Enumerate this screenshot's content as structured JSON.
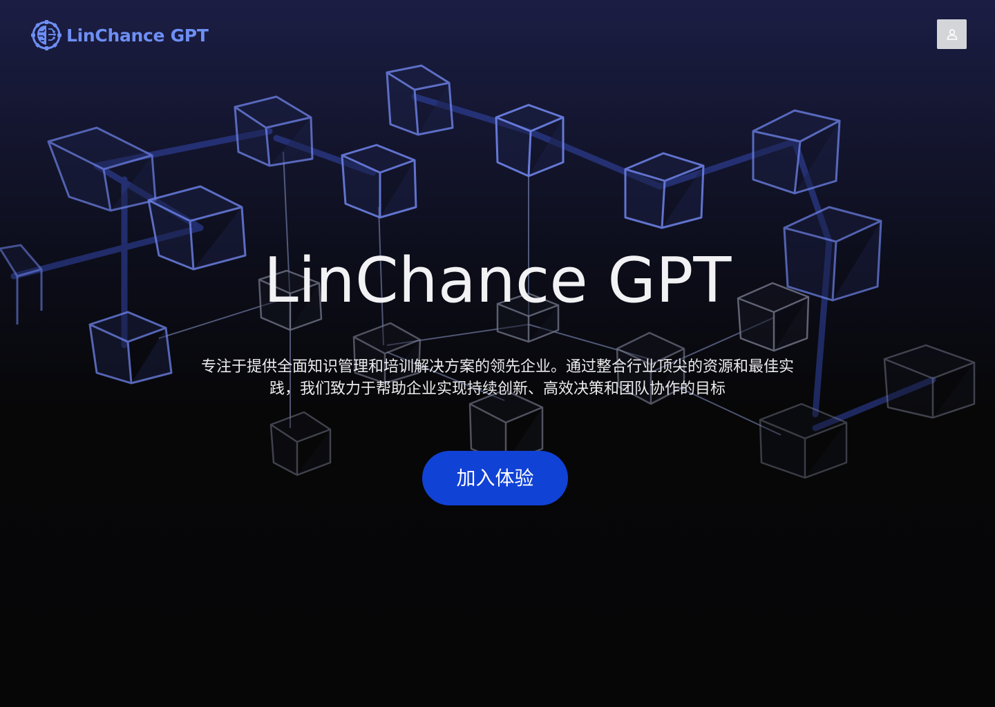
{
  "header": {
    "logo_text": "LinChance GPT",
    "logo_icon": "brain-gear-icon",
    "user_icon": "user-icon"
  },
  "hero": {
    "title": "LinChance GPT",
    "description": "专注于提供全面知识管理和培训解决方案的领先企业。通过整合行业顶尖的资源和最佳实践，我们致力于帮助企业实现持续创新、高效决策和团队协作的目标",
    "cta_label": "加入体验"
  },
  "colors": {
    "brand": "#6d8ff4",
    "cta": "#1142d6",
    "background_top": "#1b1d44",
    "background_bottom": "#060607"
  }
}
